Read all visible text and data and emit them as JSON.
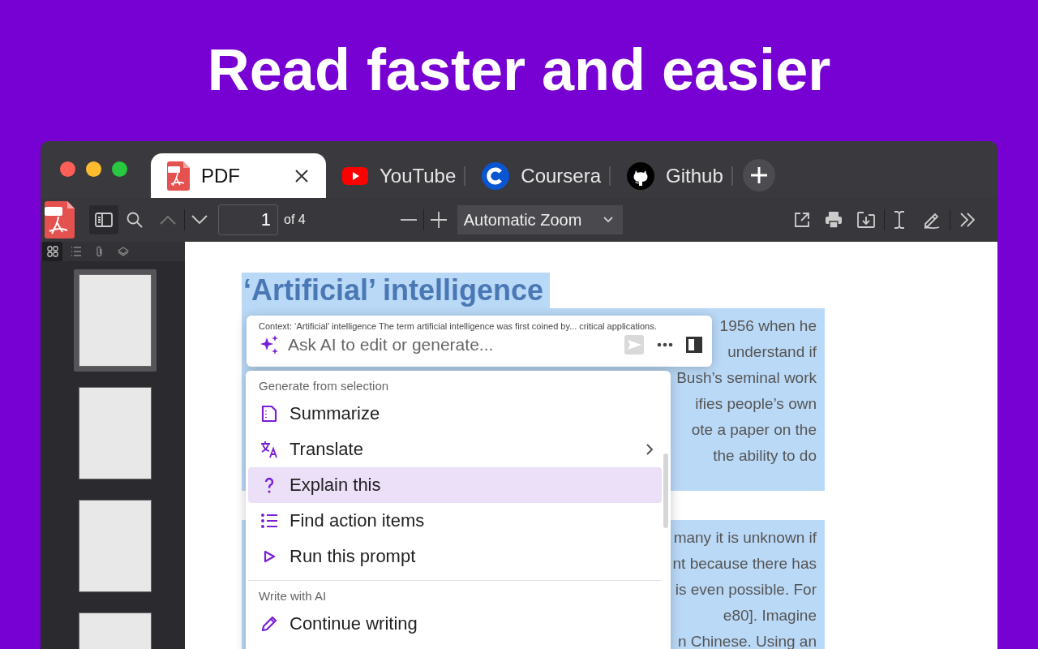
{
  "headline": "Read faster and easier",
  "tabs": [
    {
      "label": "PDF",
      "selected": true
    },
    {
      "label": "YouTube",
      "selected": false
    },
    {
      "label": "Coursera",
      "selected": false
    },
    {
      "label": "Github",
      "selected": false
    }
  ],
  "toolbar": {
    "page_number": "1",
    "page_count": "of 4",
    "zoom": "Automatic Zoom"
  },
  "sidebar": {
    "views": [
      {
        "selected": true
      },
      {
        "selected": false
      },
      {
        "selected": false
      },
      {
        "selected": false
      }
    ],
    "thumbnails": [
      {
        "selected": true
      },
      {
        "selected": false
      },
      {
        "selected": false
      },
      {
        "selected": false
      }
    ]
  },
  "document": {
    "heading": "‘Artificial’ intelligence",
    "paragraphs": [
      {
        "lines": [
          "1956 when he",
          "understand if",
          "Bush’s seminal work",
          "ifies people’s own",
          "ote a paper on the",
          "the ability to do"
        ]
      },
      {
        "lines": [
          "many it is unknown if",
          "nt because there has",
          "is even possible. For",
          "e80]. Imagine",
          "n Chinese. Using an"
        ]
      }
    ]
  },
  "ai_bar": {
    "context": "Context: ‘Artificial’ intelligence The term artificial intelligence was first coined by... critical applications.",
    "placeholder": "Ask AI to edit or generate..."
  },
  "menu": {
    "sections": [
      {
        "title": "Generate from selection",
        "items": [
          {
            "label": "Summarize",
            "selected": false,
            "has_submenu": false
          },
          {
            "label": "Translate",
            "selected": false,
            "has_submenu": true
          },
          {
            "label": "Explain this",
            "selected": true,
            "has_submenu": false
          },
          {
            "label": "Find action items",
            "selected": false,
            "has_submenu": false
          },
          {
            "label": "Run this prompt",
            "selected": false,
            "has_submenu": false
          }
        ]
      },
      {
        "title": "Write with AI",
        "items": [
          {
            "label": "Continue writing",
            "selected": false,
            "has_submenu": false
          }
        ]
      }
    ]
  }
}
